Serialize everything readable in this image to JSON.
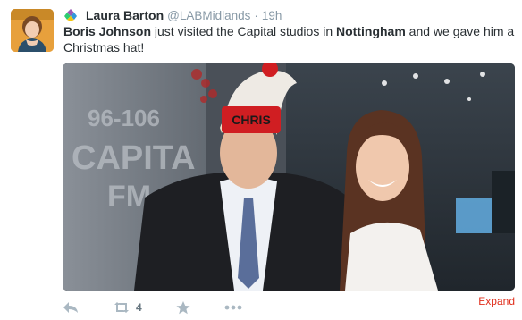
{
  "tweet": {
    "avatar_icon": "profile-photo",
    "context_icon": "colorful-diamond-icon",
    "author_name": "Laura Barton",
    "username": "@LABMidlands",
    "separator": "·",
    "time": "19h",
    "text_parts": [
      {
        "text": "Boris Johnson",
        "bold": true
      },
      {
        "text": " just visited the Capital studios in ",
        "bold": false
      },
      {
        "text": "Nottingham",
        "bold": true
      },
      {
        "text": " and we gave him a Christmas hat!",
        "bold": false
      }
    ],
    "photo": {
      "sign_text": "96-106 CAPITAL FM",
      "hat_text": "CHRIS",
      "accent_color": "#e0301e"
    },
    "expand_label": "Expand",
    "actions": {
      "reply_icon": "reply-icon",
      "retweet_icon": "retweet-icon",
      "retweet_count": "4",
      "favorite_icon": "star-icon",
      "more_icon": "more-dots-icon"
    }
  }
}
